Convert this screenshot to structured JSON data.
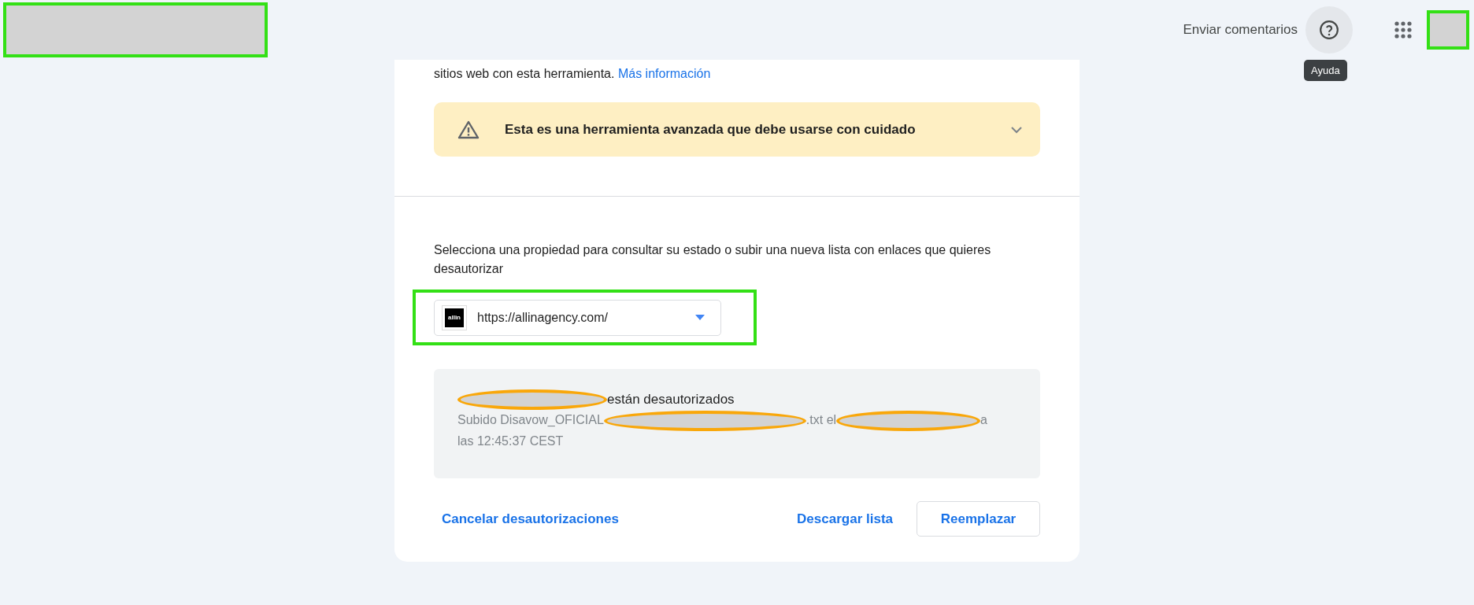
{
  "header": {
    "feedback": "Enviar comentarios",
    "help_tooltip": "Ayuda"
  },
  "intro": {
    "text": "sitios web con esta herramienta.",
    "link": "Más información"
  },
  "warning": {
    "text": "Esta es una herramienta avanzada que debe usarse con cuidado",
    "expanded": false
  },
  "prompt": "Selecciona una propiedad para consultar su estado o subir una nueva lista con enlaces que quieres desautorizar",
  "property_select": {
    "value": "https://allinagency.com/",
    "logo": "allin"
  },
  "status": {
    "title": "están desautorizados",
    "detail": [
      "Subido Disavow_OFICIAL",
      ".txt el",
      "a",
      "las 12:45:37 CEST"
    ]
  },
  "actions": {
    "cancel": "Cancelar desautorizaciones",
    "download": "Descargar lista",
    "replace": "Reemplazar"
  }
}
